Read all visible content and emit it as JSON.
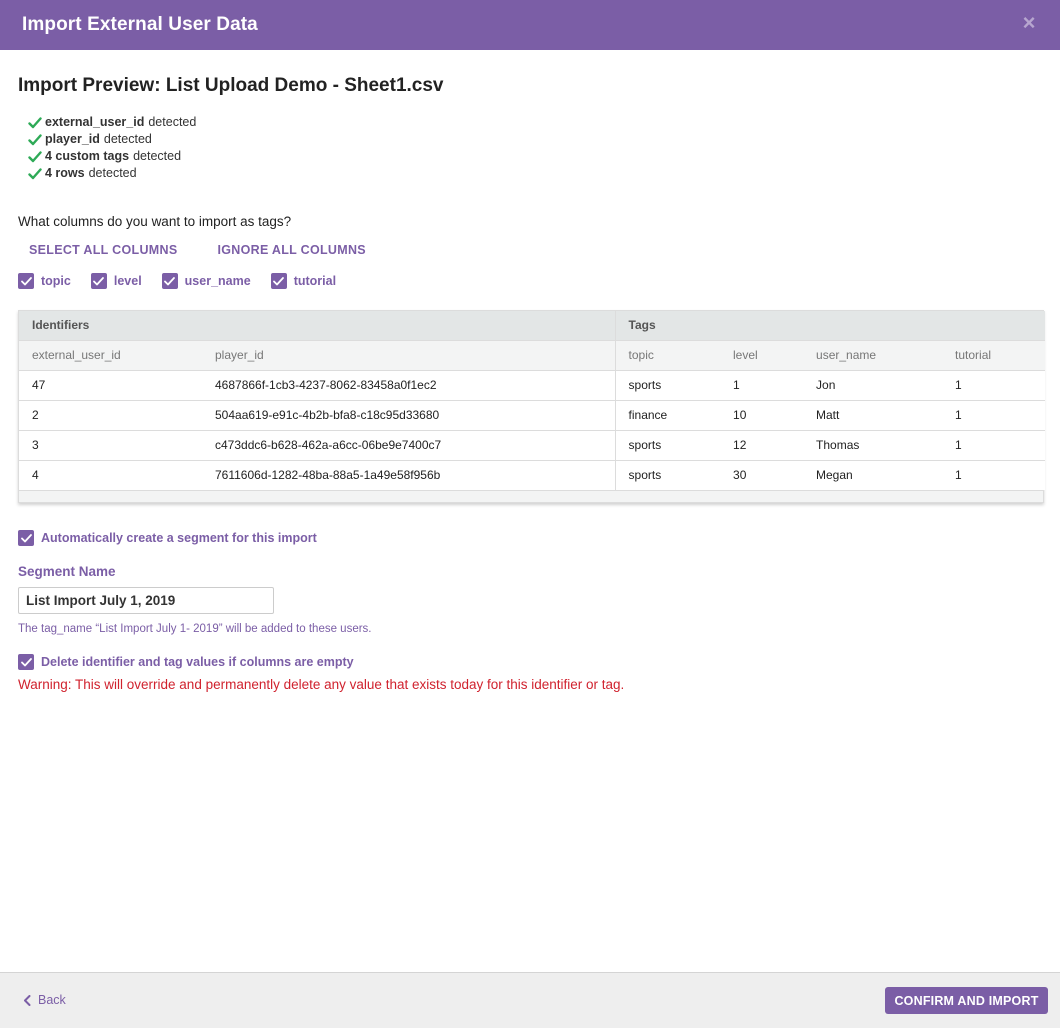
{
  "modal": {
    "title": "Import External User Data",
    "close_symbol": "×"
  },
  "preview": {
    "title": "Import Preview: List Upload Demo - Sheet1.csv",
    "detected": [
      {
        "bold": "external_user_id",
        "text": "detected"
      },
      {
        "bold": "player_id",
        "text": "detected"
      },
      {
        "bold": "4 custom tags",
        "text": "detected"
      },
      {
        "bold": "4 rows",
        "text": "detected"
      }
    ]
  },
  "columns": {
    "question": "What columns do you want to import as tags?",
    "select_all": "SELECT ALL COLUMNS",
    "ignore_all": "IGNORE ALL COLUMNS",
    "tags": [
      {
        "label": "topic",
        "checked": true
      },
      {
        "label": "level",
        "checked": true
      },
      {
        "label": "user_name",
        "checked": true
      },
      {
        "label": "tutorial",
        "checked": true
      }
    ]
  },
  "table": {
    "group_identifiers": "Identifiers",
    "group_tags": "Tags",
    "headers": [
      "external_user_id",
      "player_id",
      "topic",
      "level",
      "user_name",
      "tutorial"
    ],
    "rows": [
      [
        "47",
        "4687866f-1cb3-4237-8062-83458a0f1ec2",
        "sports",
        "1",
        "Jon",
        "1"
      ],
      [
        "2",
        "504aa619-e91c-4b2b-bfa8-c18c95d33680",
        "finance",
        "10",
        "Matt",
        "1"
      ],
      [
        "3",
        "c473ddc6-b628-462a-a6cc-06be9e7400c7",
        "sports",
        "12",
        "Thomas",
        "1"
      ],
      [
        "4",
        "7611606d-1282-48ba-88a5-1a49e58f956b",
        "sports",
        "30",
        "Megan",
        "1"
      ]
    ]
  },
  "segment": {
    "auto_create_label": "Automatically create a segment for this import",
    "name_label": "Segment Name",
    "name_value": "List Import July 1, 2019",
    "help_text": "The tag_name “List Import July 1- 2019” will be added to these users."
  },
  "delete_empty": {
    "label": "Delete identifier and tag values if columns are empty",
    "warning": "Warning: This will override and permanently delete any value that exists today for this identifier or tag."
  },
  "footer": {
    "back_label": "Back",
    "confirm_label": "CONFIRM AND IMPORT"
  },
  "colors": {
    "brand": "#7b5ea6",
    "success": "#2eaa57",
    "warning": "#d0222e"
  }
}
